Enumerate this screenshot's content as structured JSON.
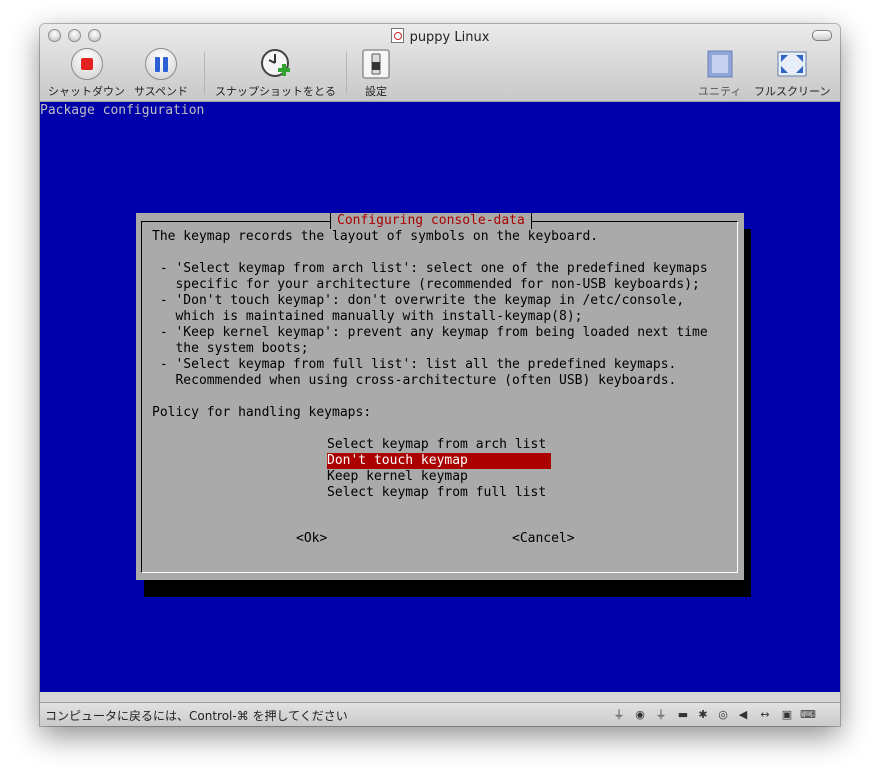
{
  "window": {
    "title": "puppy Linux"
  },
  "toolbar": {
    "shutdown_label": "シャットダウン",
    "suspend_label": "サスペンド",
    "snapshot_label": "スナップショットをとる",
    "settings_label": "設定",
    "unity_label": "ユニティ",
    "fullscreen_label": "フルスクリーン"
  },
  "console": {
    "header": "Package configuration",
    "dialog": {
      "title": "Configuring console-data",
      "lines": [
        "The keymap records the layout of symbols on the keyboard.",
        "",
        " - 'Select keymap from arch list': select one of the predefined keymaps",
        "   specific for your architecture (recommended for non-USB keyboards);",
        " - 'Don't touch keymap': don't overwrite the keymap in /etc/console,",
        "   which is maintained manually with install-keymap(8);",
        " - 'Keep kernel keymap': prevent any keymap from being loaded next time",
        "   the system boots;",
        " - 'Select keymap from full list': list all the predefined keymaps.",
        "   Recommended when using cross-architecture (often USB) keyboards.",
        "",
        "Policy for handling keymaps:"
      ],
      "options": [
        "Select keymap from arch list",
        "Don't touch keymap",
        "Keep kernel keymap",
        "Select keymap from full list"
      ],
      "selected_index": 1,
      "ok_label": "<Ok>",
      "cancel_label": "<Cancel>"
    }
  },
  "statusbar": {
    "hint": "コンピュータに戻るには、Control-⌘ を押してください"
  },
  "colors": {
    "console_bg": "#0000aa",
    "dialog_bg": "#aaaaaa",
    "dialog_title": "#aa0000",
    "selection_bg": "#aa0000"
  },
  "icons": [
    "shutdown-icon",
    "suspend-icon",
    "snapshot-icon",
    "settings-icon",
    "unity-icon",
    "fullscreen-icon",
    "usb-icon",
    "webcam-icon",
    "usb-device-icon",
    "network-icon",
    "bluetooth-icon",
    "disc-icon",
    "speaker-icon",
    "arrows-icon",
    "lock-icon",
    "keyboard-icon"
  ]
}
